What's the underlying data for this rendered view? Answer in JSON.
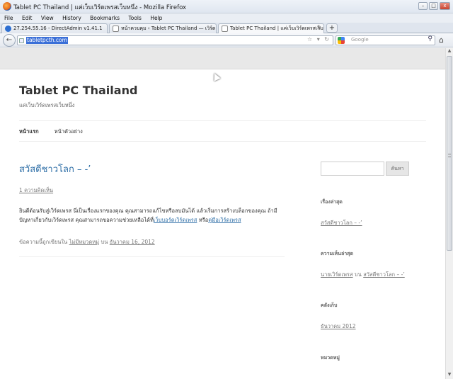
{
  "window": {
    "title": "Tablet PC Thailand | แค่เว็บเวิร์ดเพรสเว็บหนึ่ง - Mozilla Firefox",
    "minimize": "–",
    "maximize": "□",
    "close": "x"
  },
  "menu": [
    "File",
    "Edit",
    "View",
    "History",
    "Bookmarks",
    "Tools",
    "Help"
  ],
  "tabs": [
    {
      "label": "27.254.55.16 - DirectAdmin v1.41.1",
      "icon_color": "#2d6fd2"
    },
    {
      "label": "หน้าควบคุม ‹ Tablet PC Thailand — เวิร์ดเ...",
      "icon_color": "#777777"
    },
    {
      "label": "Tablet PC Thailand | แค่เว็บเวิร์ดเพรสเว็บหนึ่ง",
      "icon_color": "#777777"
    }
  ],
  "new_tab": "+",
  "nav": {
    "url": "tabletpcth.com",
    "search_placeholder": "Google",
    "icons": "☆ ▾ ↻"
  },
  "site": {
    "title": "Tablet PC Thailand",
    "description": "แค่เว็บเวิร์ดเพรสเว็บหนึ่ง",
    "menu": [
      {
        "label": "หน้าแรก",
        "current": true
      },
      {
        "label": "หน้าตัวอย่าง",
        "current": false
      }
    ]
  },
  "post": {
    "title": "สวัสดีชาวโลก – -’",
    "comments": "1 ความคิดเห็น",
    "body_text": "ยินดีต้อนรับสู่เวิร์ดเพรส นี่เป็นเรื่องแรกของคุณ คุณสามารถแก้ไขหรือลบมันได้ แล้วเริ่มการสร้างบล็อกของคุณ ถ้ามีปัญหาเกี่ยวกับเวิร์ดเพรส คุณสามารถขอความช่วยเหลือได้ที่",
    "forum_link": "เว็บบอร์ดเวิร์ดเพรส",
    "or_text": " หรือ",
    "docs_link": "คู่มือเวิร์ดเพรส",
    "meta_prefix": "ข้อความนี้ถูกเขียนใน ",
    "meta_category": "ไม่มีหมวดหมู่",
    "meta_on": " บน ",
    "meta_date": "ธันวาคม 16, 2012"
  },
  "sidebar": {
    "search_button": "ค้นหา",
    "recent_posts_title": "เรื่องล่าสุด",
    "recent_post": "สวัสดีชาวโลก – -’",
    "recent_comments_title": "ความเห็นล่าสุด",
    "comment_author": "นายเวิร์ดเพรส",
    "comment_on": " บน ",
    "comment_post": "สวัสดีชาวโลก – -’",
    "archives_title": "คลังเก็บ",
    "archive_item": "ธันวาคม 2012",
    "categories_title": "หมวดหมู่"
  }
}
